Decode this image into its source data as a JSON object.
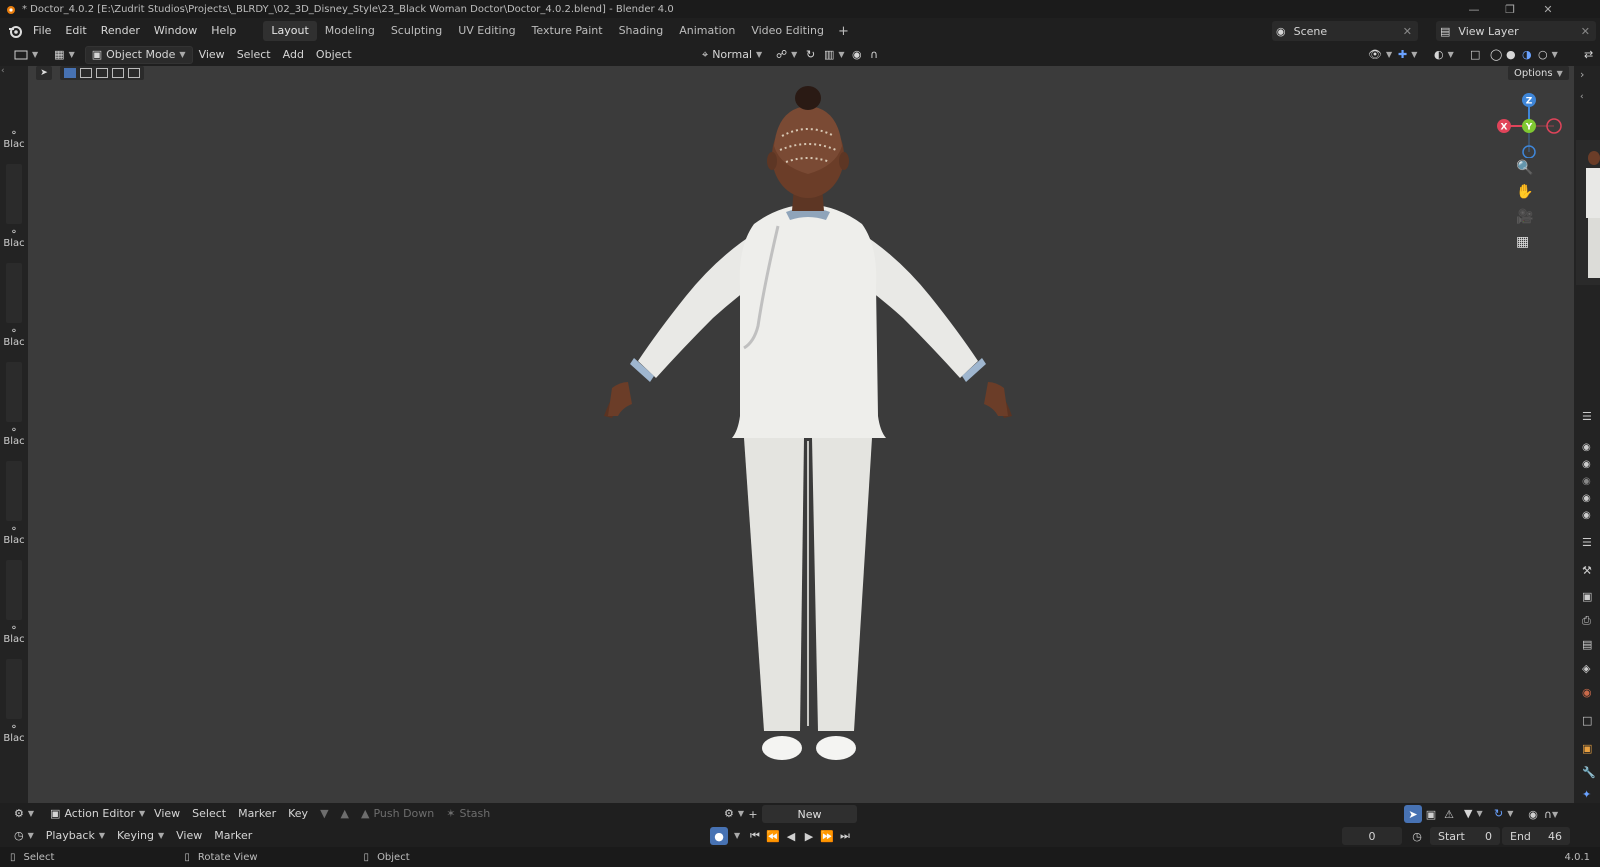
{
  "window": {
    "title": "* Doctor_4.0.2 [E:\\Zudrit Studios\\Projects\\_BLRDY_\\02_3D_Disney_Style\\23_Black Woman Doctor\\Doctor_4.0.2.blend] - Blender 4.0"
  },
  "menu": {
    "file": "File",
    "edit": "Edit",
    "render": "Render",
    "window": "Window",
    "help": "Help"
  },
  "workspaces": [
    "Layout",
    "Modeling",
    "Sculpting",
    "UV Editing",
    "Texture Paint",
    "Shading",
    "Animation",
    "Video Editing"
  ],
  "active_workspace": "Layout",
  "scene": {
    "name": "Scene",
    "view_layer": "View Layer"
  },
  "viewport_header": {
    "mode": "Object Mode",
    "view": "View",
    "select": "Select",
    "add": "Add",
    "object": "Object",
    "orientation": "Normal",
    "options": "Options"
  },
  "left_strip_label": "Blac",
  "action_editor": {
    "mode": "Action Editor",
    "view": "View",
    "select": "Select",
    "marker": "Marker",
    "key": "Key",
    "push_down": "Push Down",
    "stash": "Stash",
    "new": "New"
  },
  "timeline": {
    "playback": "Playback",
    "keying": "Keying",
    "view": "View",
    "marker": "Marker",
    "current_frame": "0",
    "start_label": "Start",
    "start": "0",
    "end_label": "End",
    "end": "46"
  },
  "status": {
    "select": "Select",
    "rotate": "Rotate View",
    "object": "Object",
    "version": "4.0.1"
  },
  "gizmo": {
    "z": "Z",
    "y": "Y",
    "x": "X"
  },
  "colors": {
    "accent": "#4772b3",
    "viewport_bg": "#3b3b3b",
    "axis_x": "#e0445a",
    "axis_y": "#7fc832",
    "axis_z": "#3f86d8"
  }
}
